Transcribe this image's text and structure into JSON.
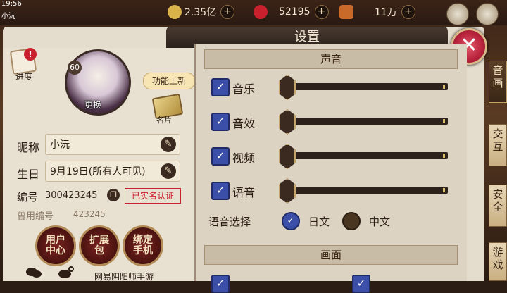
{
  "status": {
    "time": "19:56",
    "user": "小沅"
  },
  "resources": [
    {
      "icon": "coin-icon",
      "value": "2.35亿"
    },
    {
      "icon": "jade-icon",
      "value": "52195"
    },
    {
      "icon": "stamina-icon",
      "value": "11万"
    }
  ],
  "dialog": {
    "title": "设置"
  },
  "profile": {
    "progress_label": "进度",
    "level": "60",
    "change_label": "更换",
    "tooltip": "功能上新",
    "card_label": "名片",
    "nickname_label": "昵称",
    "nickname": "小沅",
    "birthday_label": "生日",
    "birthday": "9月19日(所有人可见)",
    "id_label": "编号",
    "id_value": "300423245",
    "verified": "已实名认证",
    "old_id_label": "曾用编号",
    "old_id_value": "423245",
    "buttons": [
      "用户\n中心",
      "扩展\n包",
      "绑定\n手机"
    ],
    "footer": "网易阴阳师手游"
  },
  "sound": {
    "header": "声音",
    "rows": [
      {
        "label": "音乐",
        "checked": true
      },
      {
        "label": "音效",
        "checked": true
      },
      {
        "label": "视频",
        "checked": true
      },
      {
        "label": "语音",
        "checked": true
      }
    ],
    "voice_select_label": "语音选择",
    "voice_options": [
      {
        "label": "日文",
        "selected": true
      },
      {
        "label": "中文",
        "selected": false
      }
    ]
  },
  "display": {
    "header": "画面"
  },
  "side_tabs": [
    "音\n画",
    "交\n互",
    "安\n全",
    "游\n戏"
  ]
}
